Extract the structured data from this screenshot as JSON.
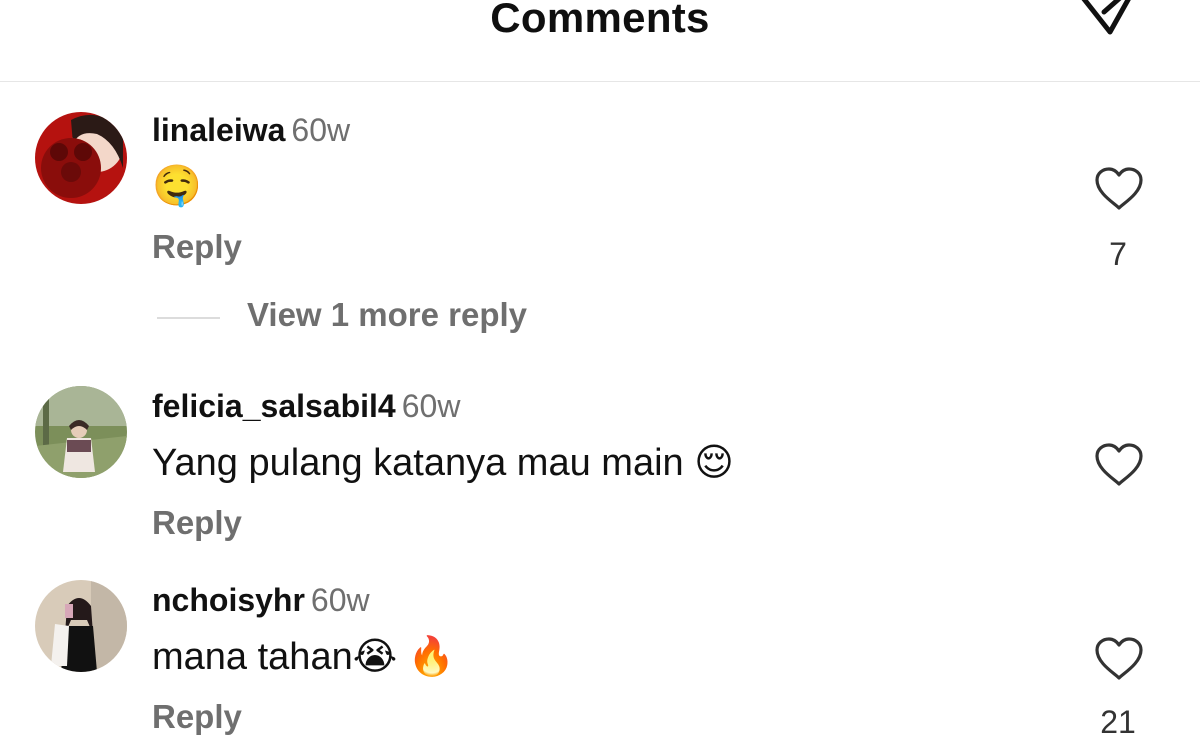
{
  "header": {
    "title": "Comments"
  },
  "comments": [
    {
      "username": "linaleiwa",
      "time": "60w",
      "text": "🤤",
      "reply": "Reply",
      "likes": "7",
      "view_more": "View 1 more reply"
    },
    {
      "username": "felicia_salsabil4",
      "time": "60w",
      "text": "Yang pulang katanya mau main 😌",
      "reply": "Reply",
      "likes": ""
    },
    {
      "username": "nchoisyhr",
      "time": "60w",
      "text": "mana tahan😭 🔥",
      "reply": "Reply",
      "likes": "21"
    }
  ],
  "icons": {
    "send": "paper-plane-icon",
    "like": "heart-outline-icon"
  },
  "colors": {
    "text": "#111111",
    "muted": "#6f6f6f",
    "divider": "#e6e6e6"
  }
}
